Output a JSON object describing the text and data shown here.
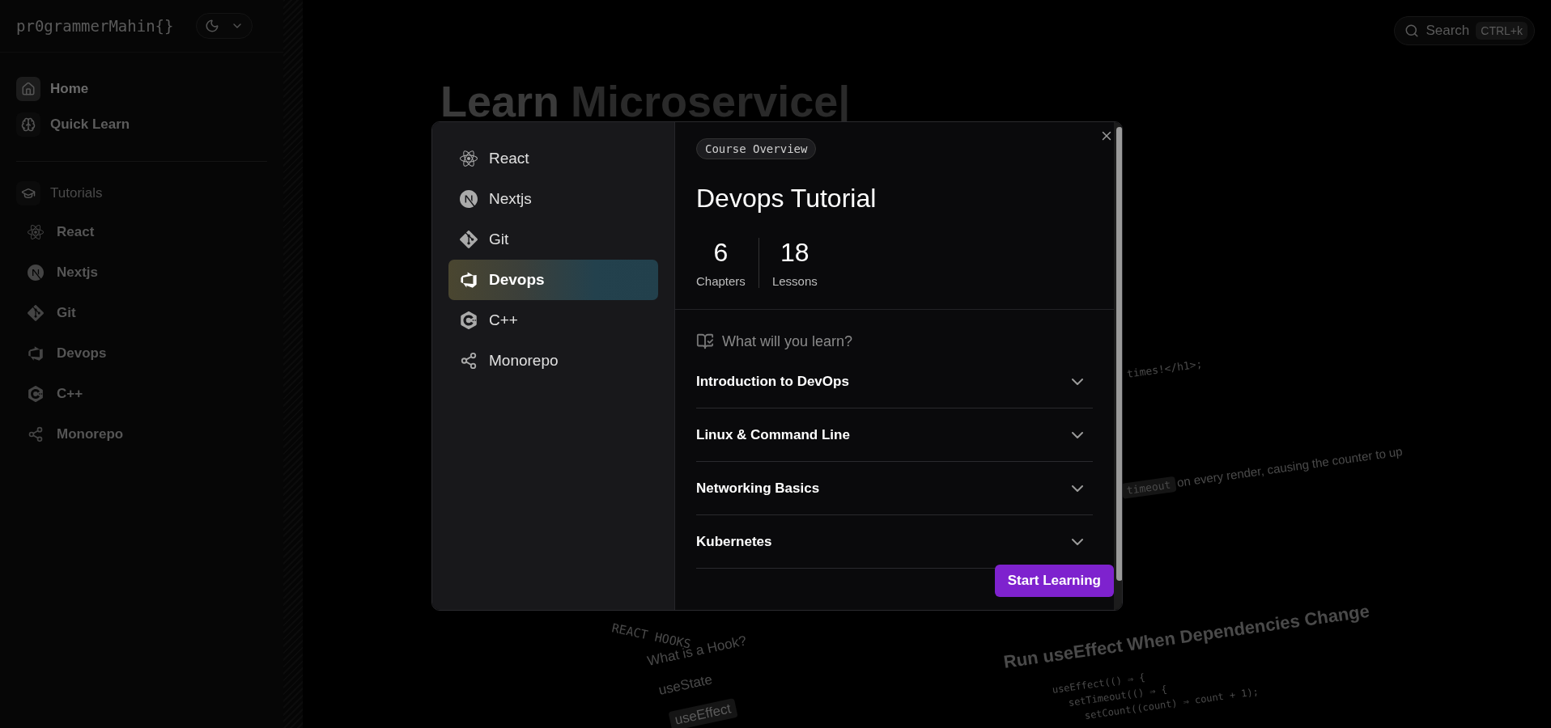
{
  "sidebar": {
    "logo": "pr0grammerMahin{}",
    "theme_toggle": {
      "dark": true
    },
    "nav": [
      {
        "label": "Home",
        "selected": true
      },
      {
        "label": "Quick Learn",
        "selected": false
      }
    ],
    "section": {
      "label": "Tutorials"
    },
    "tutorials": [
      {
        "label": "React"
      },
      {
        "label": "Nextjs"
      },
      {
        "label": "Git"
      },
      {
        "label": "Devops"
      },
      {
        "label": "C++"
      },
      {
        "label": "Monorepo"
      }
    ]
  },
  "header": {
    "search": {
      "placeholder": "Search",
      "shortcut": "CTRL+k"
    }
  },
  "hero": {
    "title": "Learn",
    "highlight": "Microservice|"
  },
  "preview": {
    "code_line": "times!</h1>;",
    "inline_code": "timeout",
    "sentence": "on every render, causing the counter to up",
    "heading": "Run useEffect When Dependencies Change",
    "toc_title": "REACT HOOKS",
    "toc_items": [
      {
        "label": "What is a Hook?",
        "selected": false
      },
      {
        "label": "useState",
        "selected": false
      },
      {
        "label": "useEffect",
        "selected": true
      }
    ],
    "code": [
      "useEffect(() ⇒ {",
      "setTimeout(() ⇒ {",
      "setCount((count) ⇒ count + 1);"
    ]
  },
  "modal": {
    "courses": [
      {
        "label": "React",
        "selected": false
      },
      {
        "label": "Nextjs",
        "selected": false
      },
      {
        "label": "Git",
        "selected": false
      },
      {
        "label": "Devops",
        "selected": true
      },
      {
        "label": "C++",
        "selected": false
      },
      {
        "label": "Monorepo",
        "selected": false
      }
    ],
    "badge": "Course Overview",
    "title": "Devops Tutorial",
    "stats": [
      {
        "value": "6",
        "label": "Chapters"
      },
      {
        "value": "18",
        "label": "Lessons"
      }
    ],
    "learn_heading": "What will you learn?",
    "topics": [
      {
        "title": "Introduction to DevOps",
        "expanded": false
      },
      {
        "title": "Linux & Command Line",
        "expanded": false
      },
      {
        "title": "Networking Basics",
        "expanded": false
      },
      {
        "title": "Kubernetes",
        "expanded": false
      }
    ],
    "button": "Start Learning"
  }
}
